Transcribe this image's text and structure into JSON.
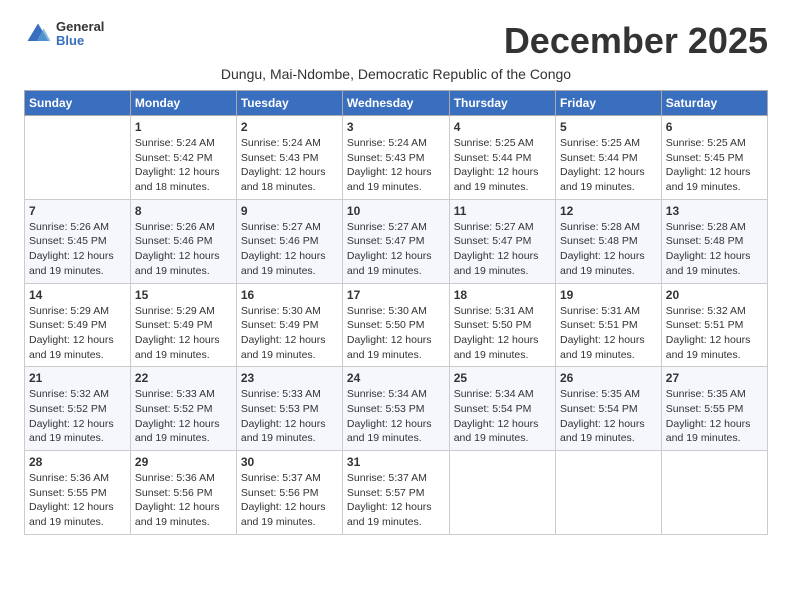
{
  "header": {
    "logo_general": "General",
    "logo_blue": "Blue",
    "month": "December 2025",
    "subtitle": "Dungu, Mai-Ndombe, Democratic Republic of the Congo"
  },
  "days_of_week": [
    "Sunday",
    "Monday",
    "Tuesday",
    "Wednesday",
    "Thursday",
    "Friday",
    "Saturday"
  ],
  "weeks": [
    [
      {
        "day": "",
        "info": ""
      },
      {
        "day": "1",
        "info": "Sunrise: 5:24 AM\nSunset: 5:42 PM\nDaylight: 12 hours\nand 18 minutes."
      },
      {
        "day": "2",
        "info": "Sunrise: 5:24 AM\nSunset: 5:43 PM\nDaylight: 12 hours\nand 18 minutes."
      },
      {
        "day": "3",
        "info": "Sunrise: 5:24 AM\nSunset: 5:43 PM\nDaylight: 12 hours\nand 19 minutes."
      },
      {
        "day": "4",
        "info": "Sunrise: 5:25 AM\nSunset: 5:44 PM\nDaylight: 12 hours\nand 19 minutes."
      },
      {
        "day": "5",
        "info": "Sunrise: 5:25 AM\nSunset: 5:44 PM\nDaylight: 12 hours\nand 19 minutes."
      },
      {
        "day": "6",
        "info": "Sunrise: 5:25 AM\nSunset: 5:45 PM\nDaylight: 12 hours\nand 19 minutes."
      }
    ],
    [
      {
        "day": "7",
        "info": "Sunrise: 5:26 AM\nSunset: 5:45 PM\nDaylight: 12 hours\nand 19 minutes."
      },
      {
        "day": "8",
        "info": "Sunrise: 5:26 AM\nSunset: 5:46 PM\nDaylight: 12 hours\nand 19 minutes."
      },
      {
        "day": "9",
        "info": "Sunrise: 5:27 AM\nSunset: 5:46 PM\nDaylight: 12 hours\nand 19 minutes."
      },
      {
        "day": "10",
        "info": "Sunrise: 5:27 AM\nSunset: 5:47 PM\nDaylight: 12 hours\nand 19 minutes."
      },
      {
        "day": "11",
        "info": "Sunrise: 5:27 AM\nSunset: 5:47 PM\nDaylight: 12 hours\nand 19 minutes."
      },
      {
        "day": "12",
        "info": "Sunrise: 5:28 AM\nSunset: 5:48 PM\nDaylight: 12 hours\nand 19 minutes."
      },
      {
        "day": "13",
        "info": "Sunrise: 5:28 AM\nSunset: 5:48 PM\nDaylight: 12 hours\nand 19 minutes."
      }
    ],
    [
      {
        "day": "14",
        "info": "Sunrise: 5:29 AM\nSunset: 5:49 PM\nDaylight: 12 hours\nand 19 minutes."
      },
      {
        "day": "15",
        "info": "Sunrise: 5:29 AM\nSunset: 5:49 PM\nDaylight: 12 hours\nand 19 minutes."
      },
      {
        "day": "16",
        "info": "Sunrise: 5:30 AM\nSunset: 5:49 PM\nDaylight: 12 hours\nand 19 minutes."
      },
      {
        "day": "17",
        "info": "Sunrise: 5:30 AM\nSunset: 5:50 PM\nDaylight: 12 hours\nand 19 minutes."
      },
      {
        "day": "18",
        "info": "Sunrise: 5:31 AM\nSunset: 5:50 PM\nDaylight: 12 hours\nand 19 minutes."
      },
      {
        "day": "19",
        "info": "Sunrise: 5:31 AM\nSunset: 5:51 PM\nDaylight: 12 hours\nand 19 minutes."
      },
      {
        "day": "20",
        "info": "Sunrise: 5:32 AM\nSunset: 5:51 PM\nDaylight: 12 hours\nand 19 minutes."
      }
    ],
    [
      {
        "day": "21",
        "info": "Sunrise: 5:32 AM\nSunset: 5:52 PM\nDaylight: 12 hours\nand 19 minutes."
      },
      {
        "day": "22",
        "info": "Sunrise: 5:33 AM\nSunset: 5:52 PM\nDaylight: 12 hours\nand 19 minutes."
      },
      {
        "day": "23",
        "info": "Sunrise: 5:33 AM\nSunset: 5:53 PM\nDaylight: 12 hours\nand 19 minutes."
      },
      {
        "day": "24",
        "info": "Sunrise: 5:34 AM\nSunset: 5:53 PM\nDaylight: 12 hours\nand 19 minutes."
      },
      {
        "day": "25",
        "info": "Sunrise: 5:34 AM\nSunset: 5:54 PM\nDaylight: 12 hours\nand 19 minutes."
      },
      {
        "day": "26",
        "info": "Sunrise: 5:35 AM\nSunset: 5:54 PM\nDaylight: 12 hours\nand 19 minutes."
      },
      {
        "day": "27",
        "info": "Sunrise: 5:35 AM\nSunset: 5:55 PM\nDaylight: 12 hours\nand 19 minutes."
      }
    ],
    [
      {
        "day": "28",
        "info": "Sunrise: 5:36 AM\nSunset: 5:55 PM\nDaylight: 12 hours\nand 19 minutes."
      },
      {
        "day": "29",
        "info": "Sunrise: 5:36 AM\nSunset: 5:56 PM\nDaylight: 12 hours\nand 19 minutes."
      },
      {
        "day": "30",
        "info": "Sunrise: 5:37 AM\nSunset: 5:56 PM\nDaylight: 12 hours\nand 19 minutes."
      },
      {
        "day": "31",
        "info": "Sunrise: 5:37 AM\nSunset: 5:57 PM\nDaylight: 12 hours\nand 19 minutes."
      },
      {
        "day": "",
        "info": ""
      },
      {
        "day": "",
        "info": ""
      },
      {
        "day": "",
        "info": ""
      }
    ]
  ]
}
